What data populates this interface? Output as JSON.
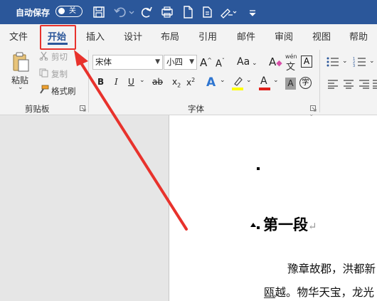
{
  "titlebar": {
    "autosave_label": "自动保存",
    "autosave_state": "关"
  },
  "tabs": [
    "文件",
    "开始",
    "插入",
    "设计",
    "布局",
    "引用",
    "邮件",
    "审阅",
    "视图",
    "帮助"
  ],
  "active_tab": "开始",
  "clipboard": {
    "paste": "粘贴",
    "cut": "剪切",
    "copy": "复制",
    "format_painter": "格式刷",
    "group_label": "剪贴板"
  },
  "font": {
    "font_name": "宋体",
    "font_size": "小四",
    "grow": "A",
    "shrink": "A",
    "change_case": "Aa",
    "phonetic_top": "wén",
    "phonetic_bottom": "文",
    "border_char": "A",
    "bold": "B",
    "italic": "I",
    "underline": "U",
    "strike": "ab",
    "subscript": "x",
    "subscript_mark": "2",
    "superscript": "x",
    "superscript_mark": "2",
    "effects": "A",
    "font_color": "A",
    "shading": "A",
    "enclosed": "字",
    "group_label": "字体"
  },
  "document": {
    "heading": "第一段",
    "line1": "豫章故郡，洪都新",
    "line2": "瓯越。物华天宝，龙光"
  },
  "colors": {
    "accent": "#2b579a",
    "annotation": "#e8322c",
    "highlight": "#ffff00",
    "font_red": "#e0201b"
  }
}
